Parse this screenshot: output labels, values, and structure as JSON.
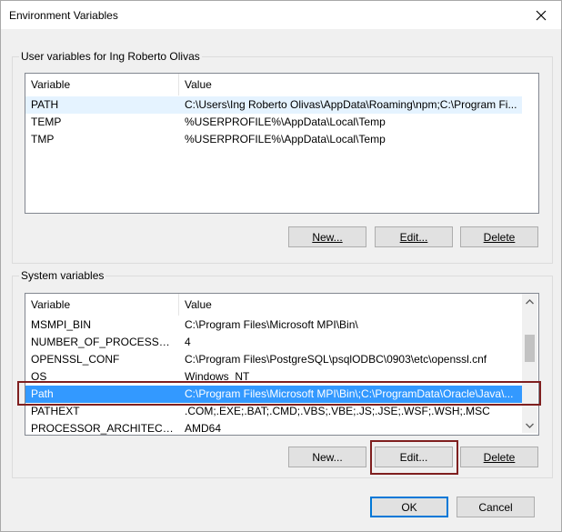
{
  "window": {
    "title": "Environment Variables"
  },
  "user_group": {
    "label": "User variables for Ing Roberto Olivas",
    "columns": [
      "Variable",
      "Value"
    ],
    "rows": [
      {
        "variable": "PATH",
        "value": "C:\\Users\\Ing Roberto Olivas\\AppData\\Roaming\\npm;C:\\Program Fi..."
      },
      {
        "variable": "TEMP",
        "value": "%USERPROFILE%\\AppData\\Local\\Temp"
      },
      {
        "variable": "TMP",
        "value": "%USERPROFILE%\\AppData\\Local\\Temp"
      }
    ],
    "buttons": {
      "new": "New...",
      "edit": "Edit...",
      "delete": "Delete"
    }
  },
  "system_group": {
    "label": "System variables",
    "columns": [
      "Variable",
      "Value"
    ],
    "rows": [
      {
        "variable": "MSMPI_BIN",
        "value": "C:\\Program Files\\Microsoft MPI\\Bin\\"
      },
      {
        "variable": "NUMBER_OF_PROCESSORS",
        "value": "4"
      },
      {
        "variable": "OPENSSL_CONF",
        "value": "C:\\Program Files\\PostgreSQL\\psqlODBC\\0903\\etc\\openssl.cnf"
      },
      {
        "variable": "OS",
        "value": "Windows_NT"
      },
      {
        "variable": "Path",
        "value": "C:\\Program Files\\Microsoft MPI\\Bin\\;C:\\ProgramData\\Oracle\\Java\\..."
      },
      {
        "variable": "PATHEXT",
        "value": ".COM;.EXE;.BAT;.CMD;.VBS;.VBE;.JS;.JSE;.WSF;.WSH;.MSC"
      },
      {
        "variable": "PROCESSOR_ARCHITECTURE",
        "value": "AMD64"
      }
    ],
    "selected_variable": "Path",
    "buttons": {
      "new": "New...",
      "edit": "Edit...",
      "delete": "Delete"
    }
  },
  "footer": {
    "ok": "OK",
    "cancel": "Cancel"
  },
  "colors": {
    "selection": "#3399ff",
    "highlight_box": "#7f1f1f"
  },
  "icons": {
    "close": "close-icon",
    "scroll_up": "chevron-up-icon",
    "scroll_down": "chevron-down-icon"
  }
}
